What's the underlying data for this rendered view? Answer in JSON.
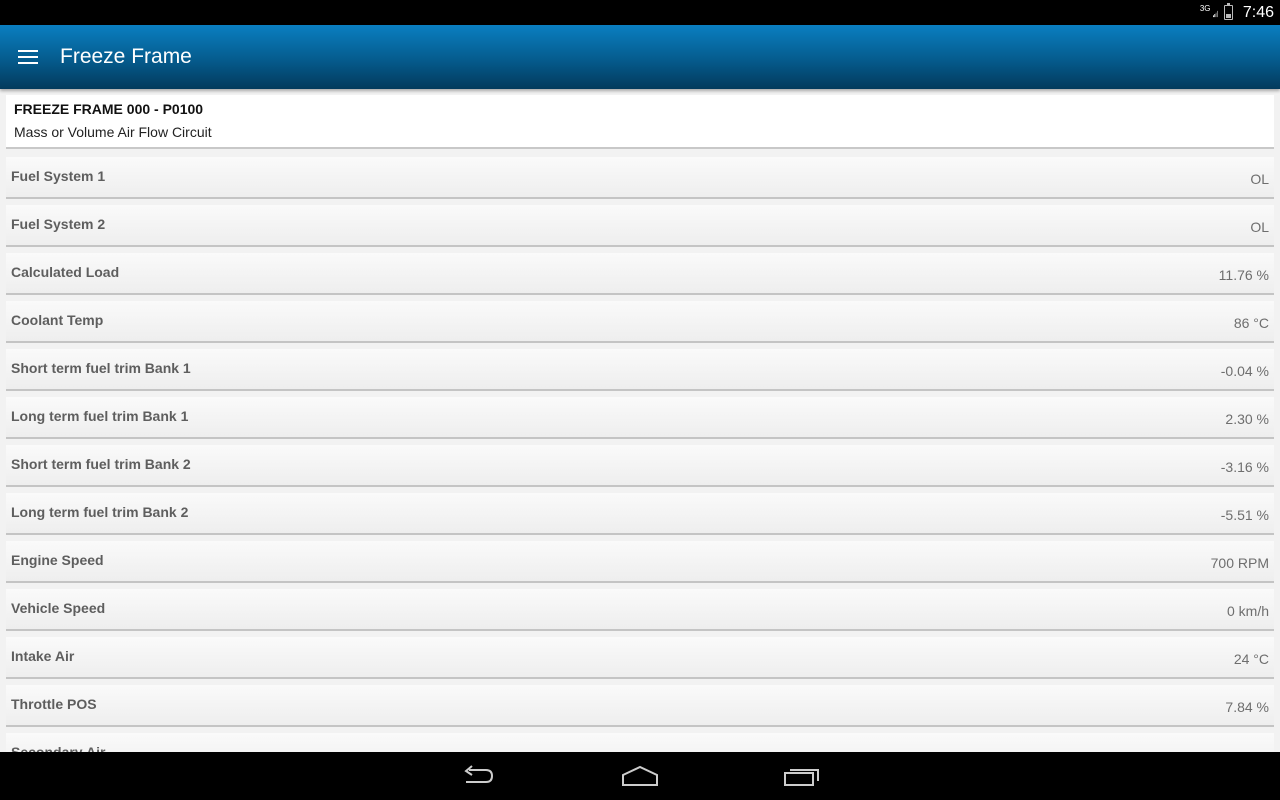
{
  "status_bar": {
    "network": "3G",
    "time": "7:46"
  },
  "action_bar": {
    "title": "Freeze Frame",
    "menu_icon": "hamburger-icon"
  },
  "freeze_frame": {
    "title": "FREEZE FRAME 000 - P0100",
    "description": "Mass or Volume Air Flow Circuit"
  },
  "rows": [
    {
      "label": "Fuel System 1",
      "value": "OL"
    },
    {
      "label": "Fuel System 2",
      "value": "OL"
    },
    {
      "label": "Calculated Load",
      "value": "11.76 %"
    },
    {
      "label": "Coolant Temp",
      "value": "86 °C"
    },
    {
      "label": "Short term fuel trim Bank 1",
      "value": "-0.04 %"
    },
    {
      "label": "Long term fuel trim Bank 1",
      "value": "2.30 %"
    },
    {
      "label": "Short term fuel trim Bank 2",
      "value": "-3.16 %"
    },
    {
      "label": "Long term fuel trim Bank 2",
      "value": "-5.51 %"
    },
    {
      "label": "Engine Speed",
      "value": "700 RPM"
    },
    {
      "label": "Vehicle Speed",
      "value": "0 km/h"
    },
    {
      "label": "Intake Air",
      "value": "24 °C"
    },
    {
      "label": "Throttle POS",
      "value": "7.84 %"
    },
    {
      "label": "Secondary Air",
      "value": ""
    }
  ],
  "nav_bar": {
    "icons": [
      "back-icon",
      "home-icon",
      "recent-apps-icon"
    ]
  },
  "colors": {
    "action_bar": "#055b8d",
    "background": "#f2f2f2"
  }
}
